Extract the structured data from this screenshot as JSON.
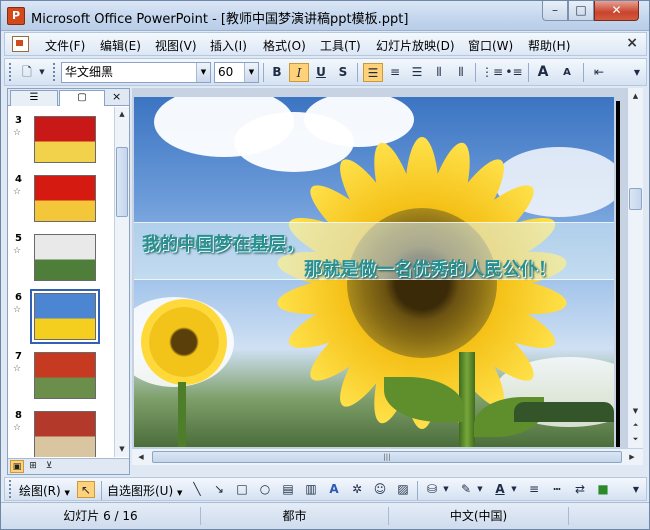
{
  "window": {
    "title": "Microsoft Office PowerPoint - [教师中国梦演讲稿ppt模板.ppt]",
    "minimize": "–",
    "maximize": "□",
    "close": "✕"
  },
  "menu": {
    "items": [
      "文件(F)",
      "编辑(E)",
      "视图(V)",
      "插入(I)",
      "格式(O)",
      "工具(T)",
      "幻灯片放映(D)",
      "窗口(W)",
      "帮助(H)"
    ],
    "close": "×"
  },
  "toolbar": {
    "font_name": "华文细黑",
    "font_size": "60",
    "bold": "B",
    "italic": "I",
    "underline": "U",
    "shadow": "S",
    "grow_font": "A",
    "shrink_font": "A"
  },
  "slide_pane": {
    "thumbnails": [
      {
        "number": "3",
        "colors": [
          "#c91818",
          "#f2d24a"
        ]
      },
      {
        "number": "4",
        "colors": [
          "#d51a12",
          "#f4c63a"
        ]
      },
      {
        "number": "5",
        "colors": [
          "#e9e9e9",
          "#4f7d3a"
        ]
      },
      {
        "number": "6",
        "colors": [
          "#4c86d3",
          "#f5cf1f"
        ],
        "selected": true
      },
      {
        "number": "7",
        "colors": [
          "#c73a22",
          "#6b8f4a"
        ]
      },
      {
        "number": "8",
        "colors": [
          "#b33a2a",
          "#d9c6a0"
        ]
      }
    ],
    "star": "☆"
  },
  "slide": {
    "line1": "我的中国梦在基层，",
    "line2": "那就是做一名优秀的人民公仆！"
  },
  "draw_toolbar": {
    "draw_label": "绘图(R)",
    "autoshapes_label": "自选图形(U)"
  },
  "status": {
    "slide_info": "幻灯片 6 / 16",
    "design": "都市",
    "language": "中文(中国)"
  }
}
